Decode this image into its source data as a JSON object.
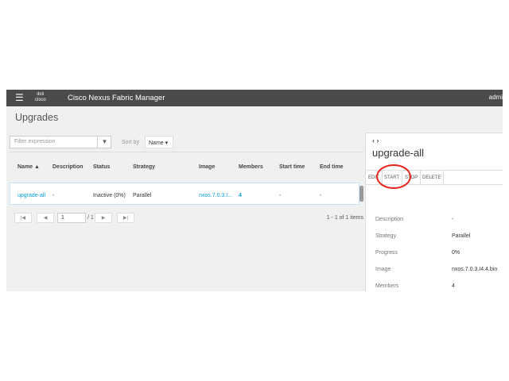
{
  "header": {
    "app_title": "Cisco Nexus Fabric Manager",
    "logo_text": "cisco",
    "user": "admi"
  },
  "page_title": "Upgrades",
  "toolbar": {
    "filter_placeholder": "Filter expression",
    "sort_label": "Sort by",
    "sort_value": "Name ▾"
  },
  "table": {
    "columns": [
      "Name ▲",
      "Description",
      "Status",
      "Strategy",
      "Image",
      "Members",
      "Start time",
      "End time"
    ],
    "rows": [
      {
        "name": "upgrade-all",
        "description": "-",
        "status": "Inactive (0%)",
        "strategy": "Parallel",
        "image": "nxos.7.0.3.I...",
        "members": "4",
        "start": "-",
        "end": "-"
      }
    ]
  },
  "pager": {
    "page": "1",
    "of": "/ 1",
    "count": "1 - 1 of 1 items"
  },
  "panel": {
    "title": "upgrade-all",
    "actions": [
      "EDIT",
      "START",
      "STOP",
      "DELETE"
    ],
    "details": [
      {
        "label": "Description",
        "value": "-"
      },
      {
        "label": "Strategy",
        "value": "Parallel"
      },
      {
        "label": "Progress",
        "value": "0%"
      },
      {
        "label": "Image",
        "value": "nxos.7.0.3.I4.4.bin"
      },
      {
        "label": "Members",
        "value": "4"
      }
    ]
  },
  "colors": {
    "link": "#049fd9",
    "header": "#4b4b4b",
    "highlight_circle": "#e8231c"
  }
}
